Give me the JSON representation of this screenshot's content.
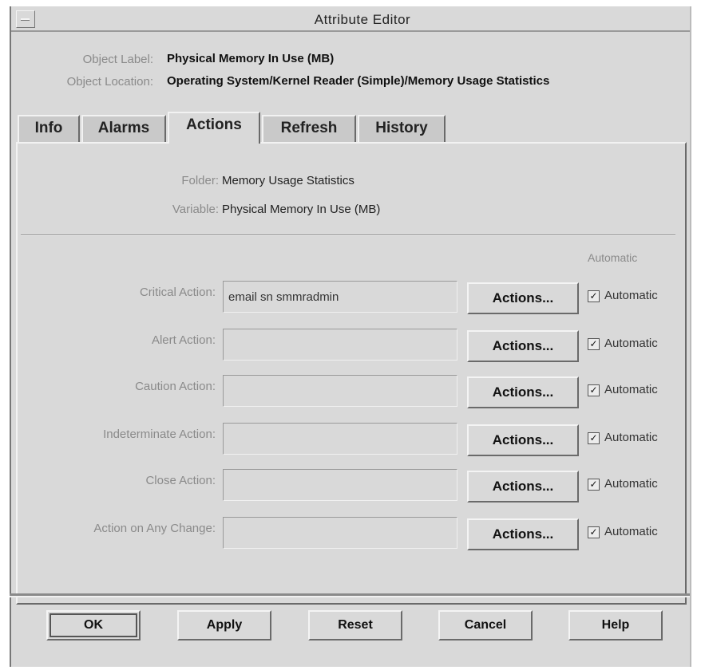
{
  "window": {
    "title": "Attribute Editor"
  },
  "object": {
    "label_caption": "Object Label:",
    "label_value": "Physical Memory In Use (MB)",
    "location_caption": "Object Location:",
    "location_value": "Operating System/Kernel Reader (Simple)/Memory Usage Statistics"
  },
  "tabs": [
    {
      "label": "Info"
    },
    {
      "label": "Alarms"
    },
    {
      "label": "Actions",
      "selected": true
    },
    {
      "label": "Refresh"
    },
    {
      "label": "History"
    }
  ],
  "panel": {
    "folder_caption": "Folder:",
    "folder_value": "Memory Usage Statistics",
    "variable_caption": "Variable:",
    "variable_value": "Physical Memory In Use (MB)",
    "automatic_header": "Automatic",
    "rows": [
      {
        "label": "Critical Action:",
        "value": "email sn smmradmin",
        "button": "Actions...",
        "auto_label": "Automatic",
        "auto_checked": true
      },
      {
        "label": "Alert Action:",
        "value": "",
        "button": "Actions...",
        "auto_label": "Automatic",
        "auto_checked": true
      },
      {
        "label": "Caution Action:",
        "value": "",
        "button": "Actions...",
        "auto_label": "Automatic",
        "auto_checked": true
      },
      {
        "label": "Indeterminate Action:",
        "value": "",
        "button": "Actions...",
        "auto_label": "Automatic",
        "auto_checked": true
      },
      {
        "label": "Close Action:",
        "value": "",
        "button": "Actions...",
        "auto_label": "Automatic",
        "auto_checked": true
      },
      {
        "label": "Action on Any Change:",
        "value": "",
        "button": "Actions...",
        "auto_label": "Automatic",
        "auto_checked": true
      }
    ]
  },
  "dialog_buttons": [
    {
      "label": "OK"
    },
    {
      "label": "Apply"
    },
    {
      "label": "Reset"
    },
    {
      "label": "Cancel"
    },
    {
      "label": "Help"
    }
  ],
  "colors": {
    "background": "#d9d9d9",
    "label_gray": "#8a8a8a"
  },
  "icons": {
    "window_menu": "window-menu-icon",
    "checkbox": "checkmark-icon"
  }
}
